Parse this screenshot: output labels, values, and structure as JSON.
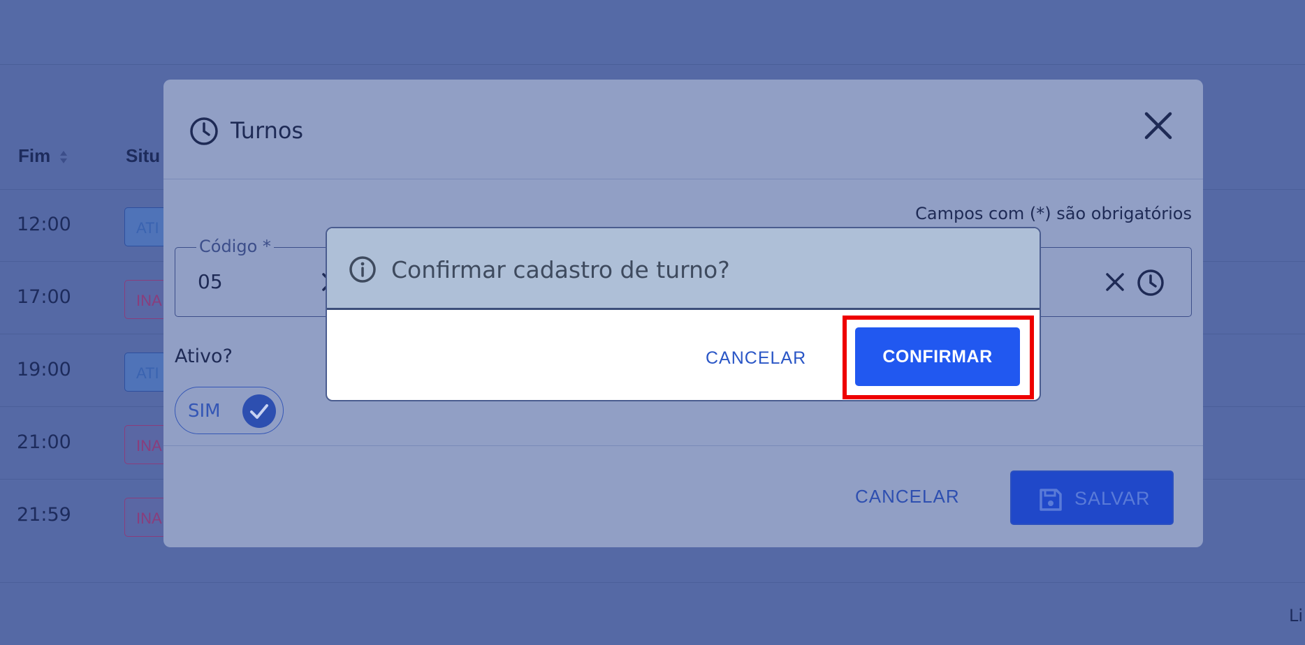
{
  "background": {
    "columns": {
      "fim": "Fim",
      "situacao": "Situ"
    },
    "rows": [
      {
        "fim": "12:00",
        "status": "ATI",
        "kind": "ativo"
      },
      {
        "fim": "17:00",
        "status": "INA",
        "kind": "inativo"
      },
      {
        "fim": "19:00",
        "status": "ATI",
        "kind": "ativo"
      },
      {
        "fim": "21:00",
        "status": "INA",
        "kind": "inativo"
      },
      {
        "fim": "21:59",
        "status": "INA",
        "kind": "inativo"
      }
    ],
    "footer_text": "Li"
  },
  "modal": {
    "title": "Turnos",
    "title_icon": "clock-icon",
    "close_icon": "close-icon",
    "required_note": "Campos com (*) são obrigatórios",
    "codigo": {
      "label": "Código *",
      "value": "05"
    },
    "ativo_label": "Ativo?",
    "toggle": {
      "label": "SIM",
      "checked": true
    },
    "cancel_label": "CANCELAR",
    "save_label": "SALVAR"
  },
  "confirm": {
    "title": "Confirmar cadastro de turno?",
    "icon": "info-icon",
    "cancel_label": "CANCELAR",
    "confirm_label": "CONFIRMAR"
  },
  "colors": {
    "overlay": "#5569a5",
    "modal_bg": "#919fc5",
    "primary": "#2158f0",
    "highlight": "#ee0000"
  }
}
